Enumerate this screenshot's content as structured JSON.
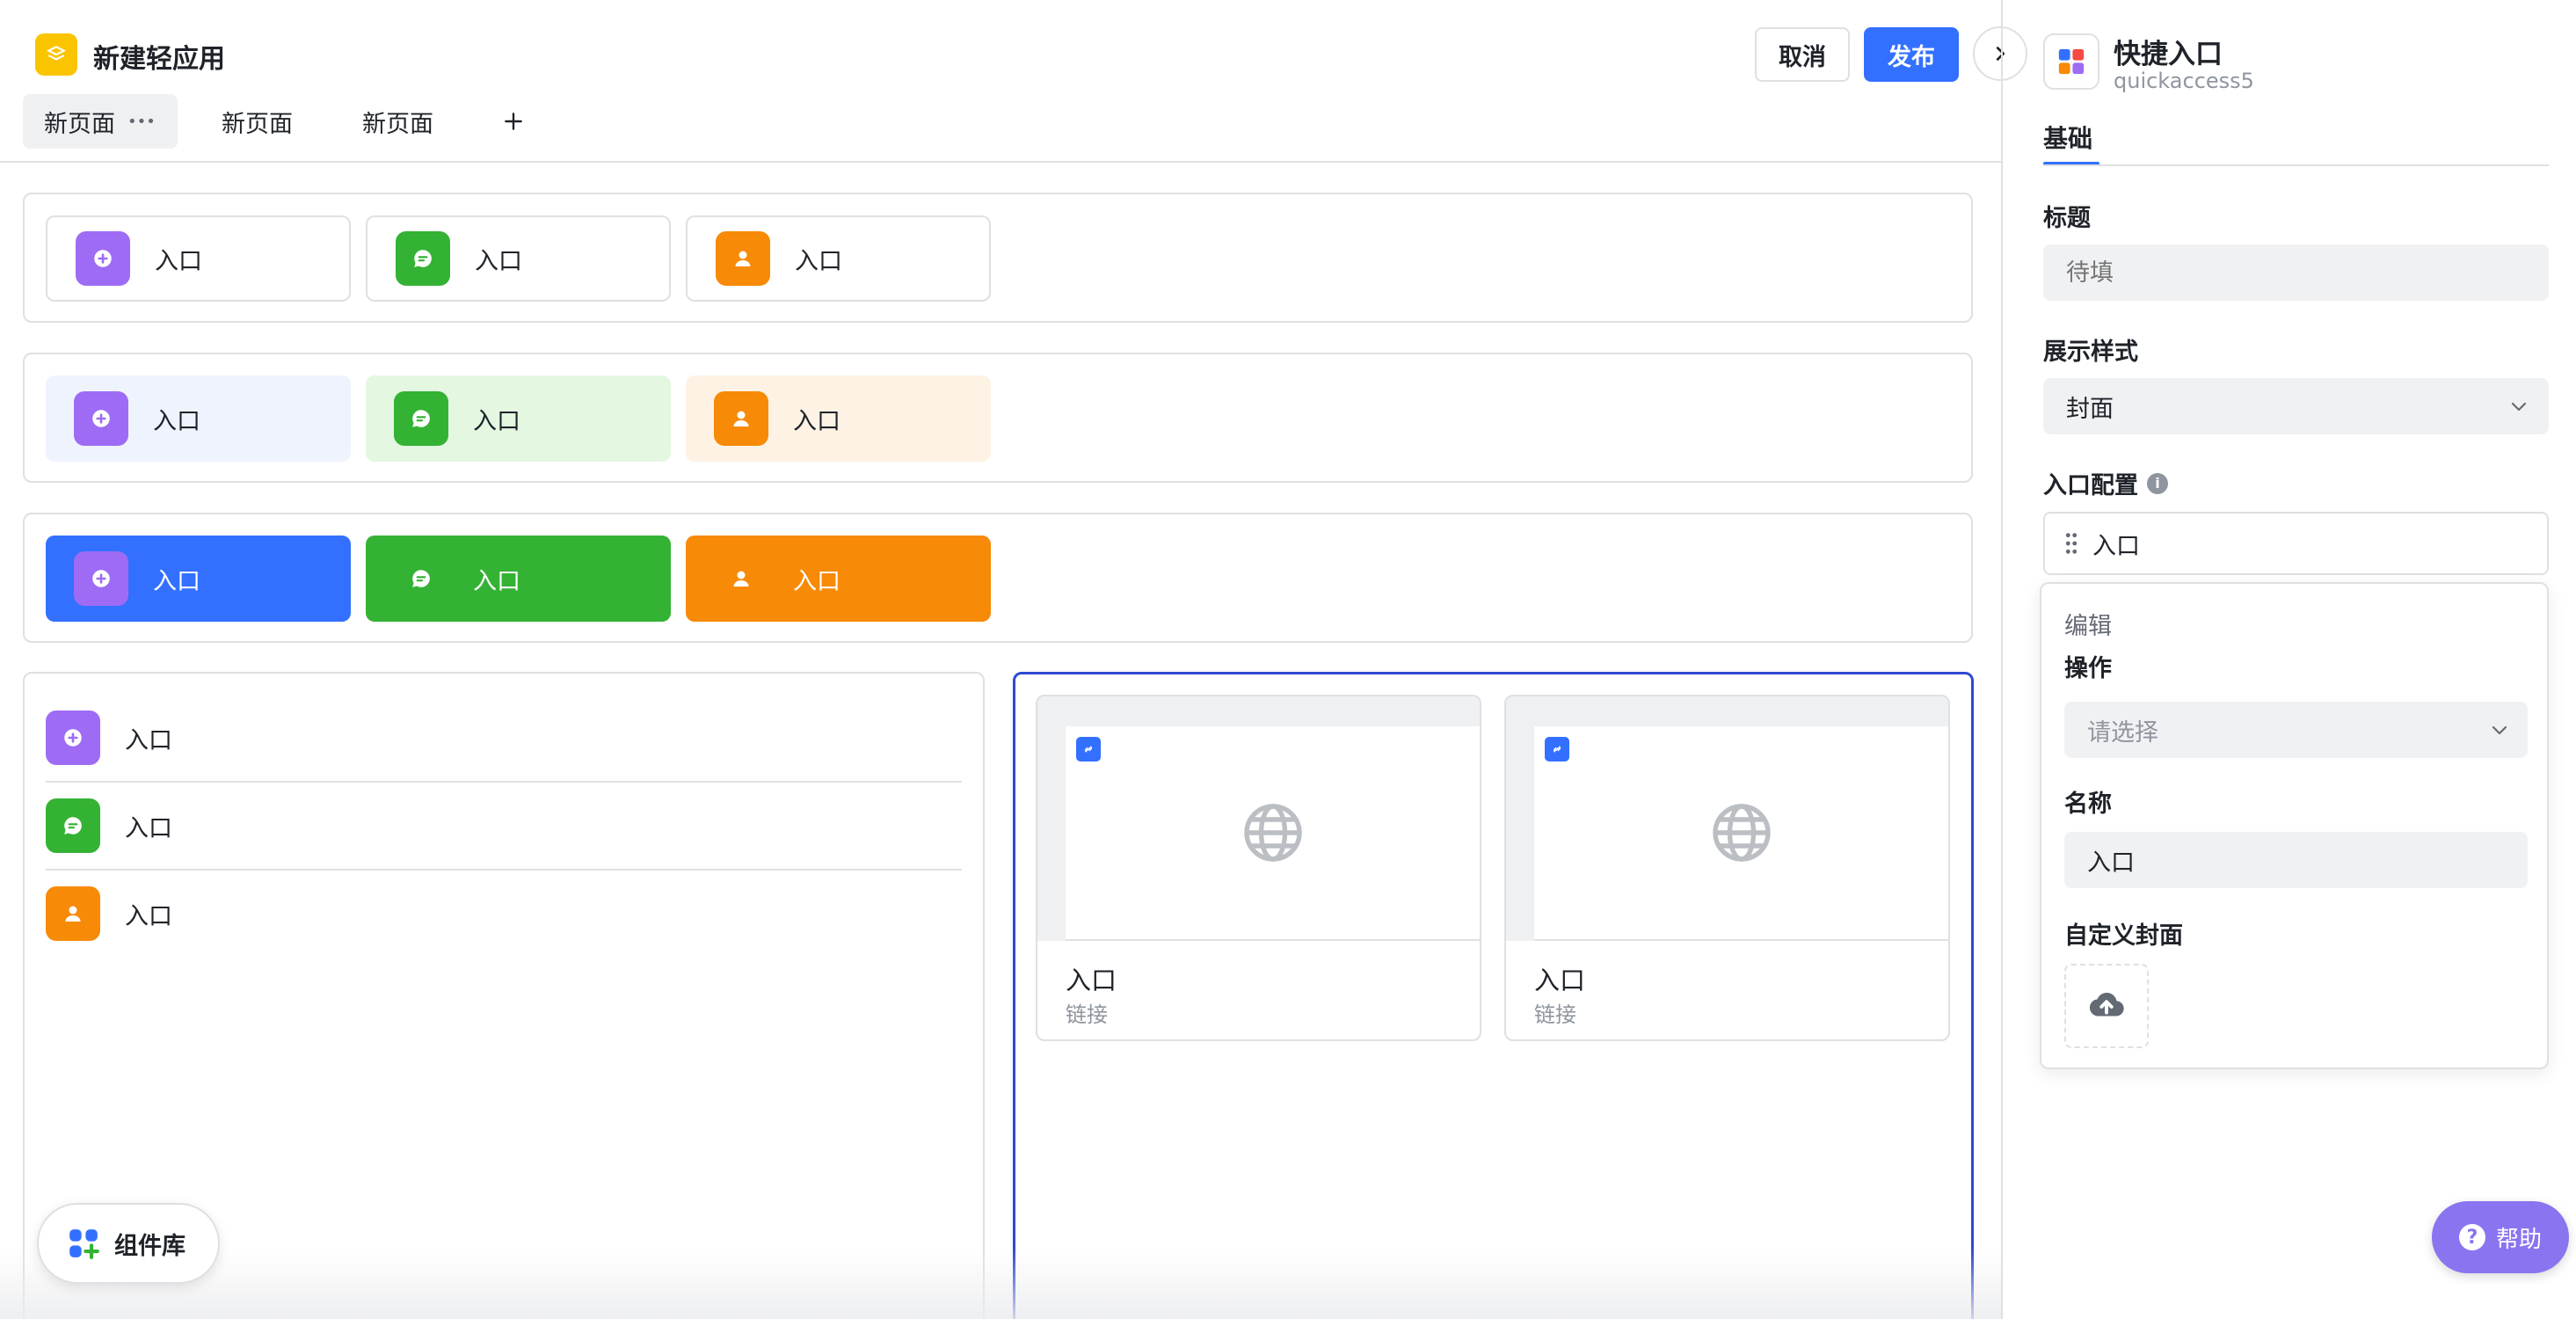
{
  "header": {
    "app_title": "新建轻应用",
    "cancel_label": "取消",
    "publish_label": "发布"
  },
  "tabs": [
    {
      "label": "新页面"
    },
    {
      "label": "新页面"
    },
    {
      "label": "新页面"
    }
  ],
  "tab_more": "•••",
  "tab_add": "+",
  "rows": {
    "outline": [
      "入口",
      "入口",
      "入口"
    ],
    "tinted": [
      "入口",
      "入口",
      "入口"
    ],
    "filled": [
      "入口",
      "入口",
      "入口"
    ]
  },
  "list": [
    "入口",
    "入口",
    "入口"
  ],
  "cards": [
    {
      "title": "入口",
      "subtitle": "链接"
    },
    {
      "title": "入口",
      "subtitle": "链接"
    }
  ],
  "component_lib_label": "组件库",
  "panel": {
    "title": "快捷入口",
    "id": "quickaccess5",
    "tab": "基础",
    "title_label": "标题",
    "title_placeholder": "待填",
    "style_label": "展示样式",
    "style_value": "封面",
    "entry_config_label": "入口配置",
    "entry_item": "入口",
    "edit_header": "编辑",
    "action_label": "操作",
    "action_placeholder": "请选择",
    "name_label": "名称",
    "name_value": "入口",
    "cover_label": "自定义封面"
  },
  "help_label": "帮助",
  "colors": {
    "primary": "#3370ff",
    "purple": "#9e6cf4",
    "green": "#34b234",
    "orange": "#f78a06",
    "border": "#dee0e3"
  }
}
